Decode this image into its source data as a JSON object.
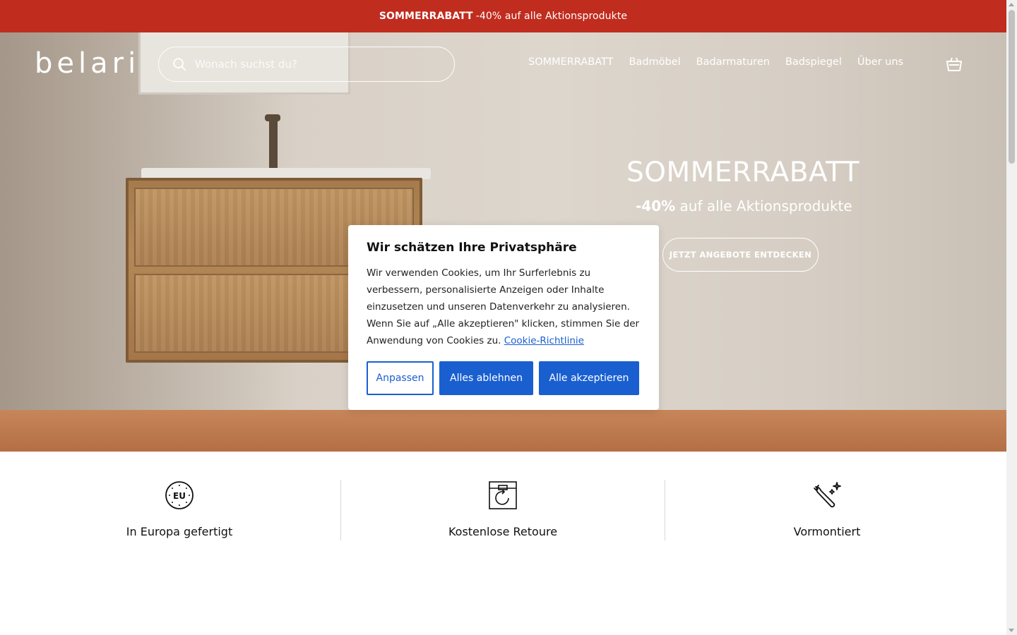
{
  "announcement": {
    "bold": "SOMMERRABATT",
    "text": "-40% auf alle Aktionsprodukte"
  },
  "header": {
    "logo": "belari",
    "search_placeholder": "Wonach suchst du?",
    "nav": [
      "SOMMERRABATT",
      "Badmöbel",
      "Badarmaturen",
      "Badspiegel",
      "Über uns"
    ],
    "cart_icon": "shopping-bag-icon"
  },
  "hero": {
    "title": "SOMMERRABATT",
    "subtitle_bold": "-40%",
    "subtitle_rest": "auf alle Aktionsprodukte",
    "cta": "JETZT ANGEBOTE ENTDECKEN"
  },
  "cookie": {
    "title": "Wir schätzen Ihre Privatsphäre",
    "body": "Wir verwenden Cookies, um Ihr Surferlebnis zu verbessern, personalisierte Anzeigen oder Inhalte einzusetzen und unseren Datenverkehr zu analysieren. Wenn Sie auf „Alle akzeptieren\" klicken, stimmen Sie der Anwendung von Cookies zu.",
    "link": "Cookie-Richtlinie",
    "customize": "Anpassen",
    "reject": "Alles ablehnen",
    "accept": "Alle akzeptieren"
  },
  "features": [
    {
      "label": "In Europa gefertigt",
      "icon": "eu-badge-icon"
    },
    {
      "label": "Kostenlose Retoure",
      "icon": "return-box-icon"
    },
    {
      "label": "Vormontiert",
      "icon": "wrench-sparkle-icon"
    }
  ],
  "colors": {
    "announcement_bg": "#c02c1e",
    "primary_blue": "#1a5fd0"
  }
}
